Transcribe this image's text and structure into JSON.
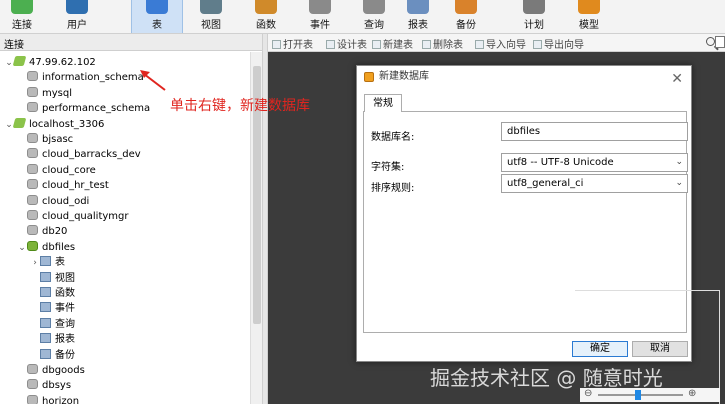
{
  "toolbar": {
    "items": [
      {
        "label": "连接",
        "icon": "connection-icon",
        "color": "#4caf50"
      },
      {
        "label": "用户",
        "icon": "user-icon",
        "color": "#2f6fb0"
      },
      {
        "label": "表",
        "icon": "table-icon",
        "color": "#3a7bd5",
        "active": true
      },
      {
        "label": "视图",
        "icon": "view-icon",
        "color": "#607d8b"
      },
      {
        "label": "函数",
        "icon": "function-icon",
        "color": "#d08a2a"
      },
      {
        "label": "事件",
        "icon": "event-icon",
        "color": "#8a8a8a"
      },
      {
        "label": "查询",
        "icon": "query-icon",
        "color": "#8a8a8a"
      },
      {
        "label": "报表",
        "icon": "report-icon",
        "color": "#6b8fbf"
      },
      {
        "label": "备份",
        "icon": "backup-icon",
        "color": "#d9822b"
      },
      {
        "label": "计划",
        "icon": "schedule-icon",
        "color": "#7a7a7a"
      },
      {
        "label": "模型",
        "icon": "model-icon",
        "color": "#e08a1e"
      }
    ]
  },
  "left_panel": {
    "header": "连接",
    "tree": [
      {
        "label": "47.99.62.102",
        "type": "connection",
        "level": 0,
        "expanded": true
      },
      {
        "label": "information_schema",
        "type": "db",
        "level": 1
      },
      {
        "label": "mysql",
        "type": "db",
        "level": 1
      },
      {
        "label": "performance_schema",
        "type": "db",
        "level": 1
      },
      {
        "label": "localhost_3306",
        "type": "connection",
        "level": 0,
        "expanded": true
      },
      {
        "label": "bjsasc",
        "type": "db",
        "level": 1
      },
      {
        "label": "cloud_barracks_dev",
        "type": "db",
        "level": 1
      },
      {
        "label": "cloud_core",
        "type": "db",
        "level": 1
      },
      {
        "label": "cloud_hr_test",
        "type": "db",
        "level": 1
      },
      {
        "label": "cloud_odi",
        "type": "db",
        "level": 1
      },
      {
        "label": "cloud_qualitymgr",
        "type": "db",
        "level": 1
      },
      {
        "label": "db20",
        "type": "db",
        "level": 1
      },
      {
        "label": "dbfiles",
        "type": "db-open",
        "level": 1,
        "expanded": true
      },
      {
        "label": "表",
        "type": "obj",
        "level": 2,
        "collapsed": true
      },
      {
        "label": "视图",
        "type": "obj",
        "level": 2
      },
      {
        "label": "函数",
        "type": "obj",
        "level": 2
      },
      {
        "label": "事件",
        "type": "obj",
        "level": 2
      },
      {
        "label": "查询",
        "type": "obj",
        "level": 2
      },
      {
        "label": "报表",
        "type": "obj",
        "level": 2
      },
      {
        "label": "备份",
        "type": "obj",
        "level": 2
      },
      {
        "label": "dbgoods",
        "type": "db",
        "level": 1
      },
      {
        "label": "dbsys",
        "type": "db",
        "level": 1
      },
      {
        "label": "horizon",
        "type": "db",
        "level": 1
      }
    ]
  },
  "subbar": {
    "items": [
      "打开表",
      "设计表",
      "新建表",
      "删除表",
      "导入向导",
      "导出向导"
    ]
  },
  "annotation": "单击右键，新建数据库",
  "dialog": {
    "title": "新建数据库",
    "tab": "常规",
    "fields": [
      {
        "label": "数据库名:",
        "value": "dbfiles",
        "dropdown": false
      },
      {
        "label": "字符集:",
        "value": "utf8 -- UTF-8 Unicode",
        "dropdown": true
      },
      {
        "label": "排序规则:",
        "value": "utf8_general_ci",
        "dropdown": true
      }
    ],
    "ok_label": "确定",
    "cancel_label": "取消"
  },
  "watermark": "掘金技术社区 @ 随意时光",
  "colors": {
    "annotation": "#e0251f",
    "content_bg": "#3b3b3b",
    "active_tab": "#cfe1f6"
  }
}
